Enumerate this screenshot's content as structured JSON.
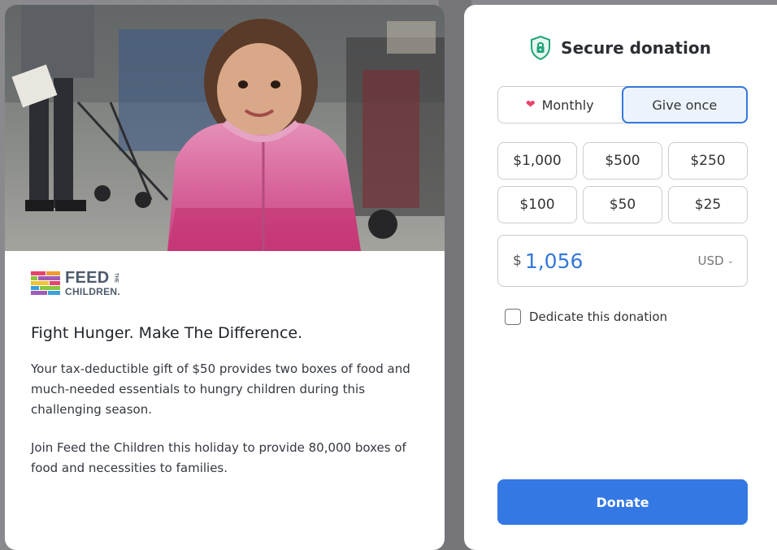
{
  "colors": {
    "accent": "#3478e4",
    "heart": "#e8436a",
    "shield": "#1fa37a",
    "text": "#1f2328"
  },
  "story": {
    "brand_line1": "FEED",
    "brand_line1_small": "THE",
    "brand_line2": "CHILDREN.",
    "title": "Fight Hunger. Make The Difference.",
    "paragraph1": "Your tax-deductible gift of $50 provides two boxes of food and much-needed essentials to hungry children during this challenging season.",
    "paragraph2": "Join Feed the Children this holiday to provide 80,000 boxes of food and necessities to families."
  },
  "donation": {
    "header_icon": "shield-lock-icon",
    "header_title": "Secure donation",
    "frequency": {
      "monthly_label": "Monthly",
      "once_label": "Give once",
      "selected": "Give once"
    },
    "amounts": [
      "$1,000",
      "$500",
      "$250",
      "$100",
      "$50",
      "$25"
    ],
    "currency_symbol": "$",
    "custom_amount": "1,056",
    "currency": "USD",
    "dedicate_label": "Dedicate this donation",
    "dedicate_checked": false,
    "donate_label": "Donate"
  }
}
